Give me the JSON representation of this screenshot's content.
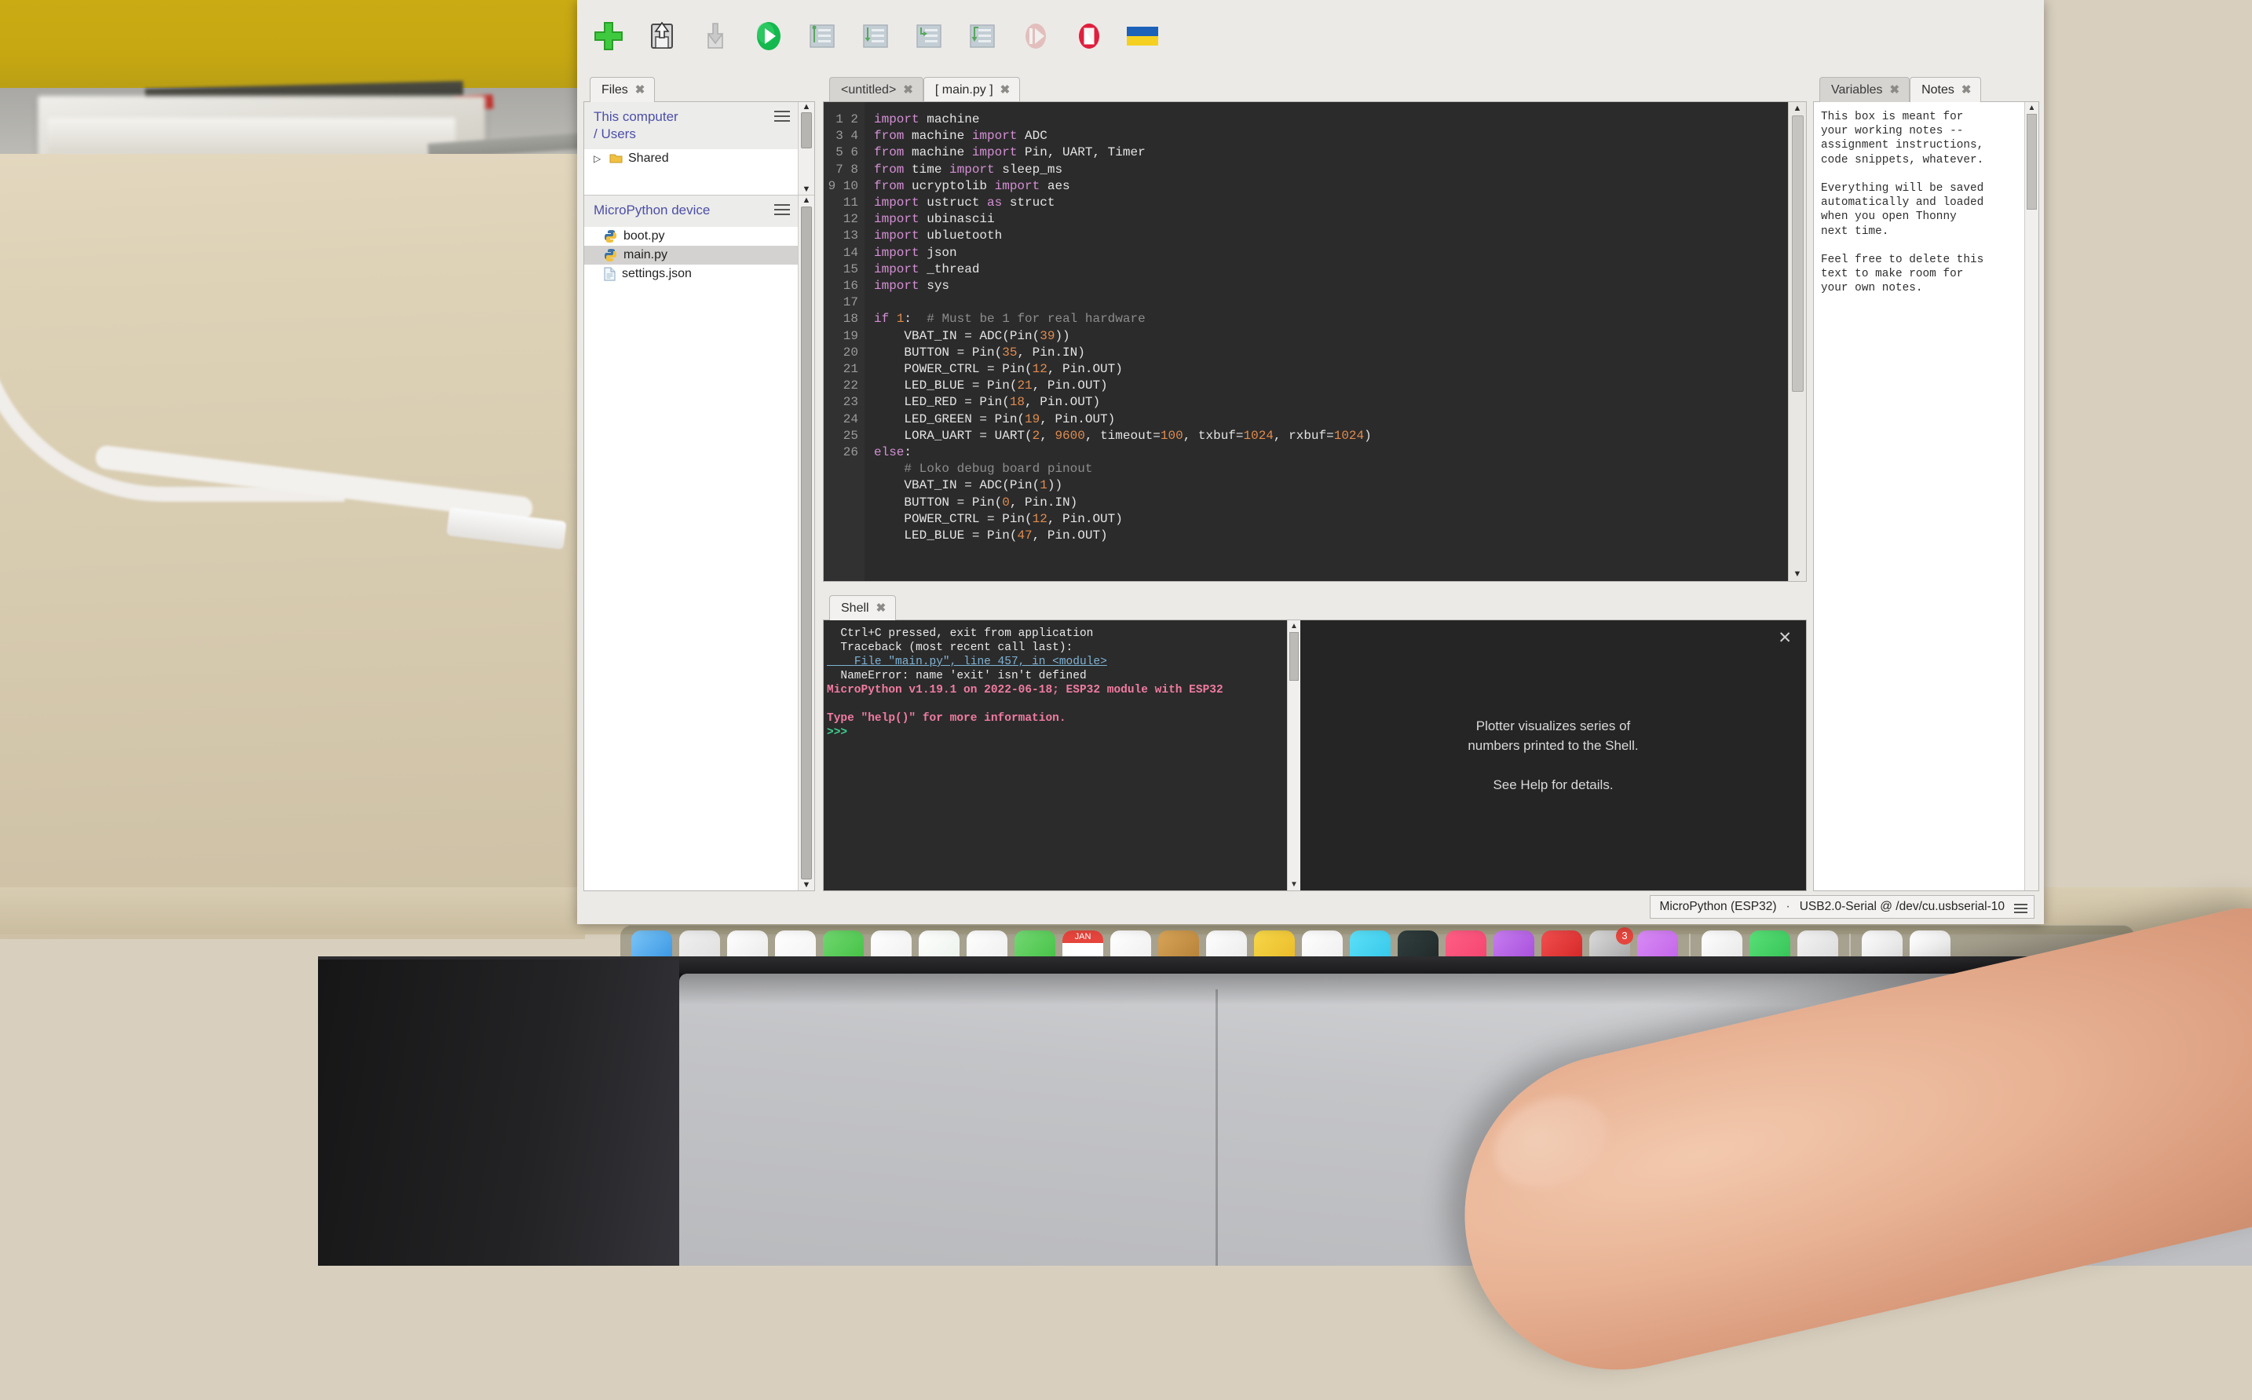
{
  "window": {
    "app": "Thonny"
  },
  "toolbar": {
    "buttons": [
      {
        "name": "new-file",
        "label": "New"
      },
      {
        "name": "save-file",
        "label": "Save"
      },
      {
        "name": "open-file",
        "label": "Open"
      },
      {
        "name": "run-script",
        "label": "Run current script"
      },
      {
        "name": "debug-script",
        "label": "Debug current script"
      },
      {
        "name": "step-over",
        "label": "Step over"
      },
      {
        "name": "step-into",
        "label": "Step into"
      },
      {
        "name": "step-out",
        "label": "Step out"
      },
      {
        "name": "resume",
        "label": "Resume"
      },
      {
        "name": "stop-script",
        "label": "Stop/Restart backend"
      },
      {
        "name": "ukraine-flag",
        "label": "Support Ukraine"
      }
    ]
  },
  "files_panel": {
    "tab": {
      "label": "Files",
      "close": "✖"
    },
    "sections": [
      {
        "title_line1": "This computer",
        "title_line2": "/ Users",
        "menu_icon": "hamburger-icon",
        "rows": [
          {
            "arrow": "▷",
            "icon": "folder-icon",
            "label": "Shared",
            "selected": false
          }
        ]
      },
      {
        "title_line1": "MicroPython device",
        "title_line2": "",
        "menu_icon": "hamburger-icon",
        "rows": [
          {
            "arrow": "",
            "icon": "python-file-icon",
            "label": "boot.py",
            "selected": false
          },
          {
            "arrow": "",
            "icon": "python-file-icon",
            "label": "main.py",
            "selected": true
          },
          {
            "arrow": "",
            "icon": "json-file-icon",
            "label": "settings.json",
            "selected": false
          }
        ]
      }
    ]
  },
  "editor": {
    "tabs": [
      {
        "label": "<untitled>",
        "close": "✖",
        "active": false
      },
      {
        "label": "[ main.py ]",
        "close": "✖",
        "active": true
      }
    ],
    "first_line": 1,
    "lines": [
      {
        "n": 1,
        "tokens": [
          [
            "kw",
            "import"
          ],
          [
            "idt",
            " machine"
          ]
        ]
      },
      {
        "n": 2,
        "tokens": [
          [
            "kw",
            "from"
          ],
          [
            "idt",
            " machine "
          ],
          [
            "kw",
            "import"
          ],
          [
            "idt",
            " ADC"
          ]
        ]
      },
      {
        "n": 3,
        "tokens": [
          [
            "kw",
            "from"
          ],
          [
            "idt",
            " machine "
          ],
          [
            "kw",
            "import"
          ],
          [
            "idt",
            " Pin, UART, Timer"
          ]
        ]
      },
      {
        "n": 4,
        "tokens": [
          [
            "kw",
            "from"
          ],
          [
            "idt",
            " time "
          ],
          [
            "kw",
            "import"
          ],
          [
            "idt",
            " sleep_ms"
          ]
        ]
      },
      {
        "n": 5,
        "tokens": [
          [
            "kw",
            "from"
          ],
          [
            "idt",
            " ucryptolib "
          ],
          [
            "kw",
            "import"
          ],
          [
            "idt",
            " aes"
          ]
        ]
      },
      {
        "n": 6,
        "tokens": [
          [
            "kw",
            "import"
          ],
          [
            "idt",
            " ustruct "
          ],
          [
            "kw",
            "as"
          ],
          [
            "idt",
            " struct"
          ]
        ]
      },
      {
        "n": 7,
        "tokens": [
          [
            "kw",
            "import"
          ],
          [
            "idt",
            " ubinascii"
          ]
        ]
      },
      {
        "n": 8,
        "tokens": [
          [
            "kw",
            "import"
          ],
          [
            "idt",
            " ubluetooth"
          ]
        ]
      },
      {
        "n": 9,
        "tokens": [
          [
            "kw",
            "import"
          ],
          [
            "idt",
            " json"
          ]
        ]
      },
      {
        "n": 10,
        "tokens": [
          [
            "kw",
            "import"
          ],
          [
            "idt",
            " _thread"
          ]
        ]
      },
      {
        "n": 11,
        "tokens": [
          [
            "kw",
            "import"
          ],
          [
            "idt",
            " sys"
          ]
        ]
      },
      {
        "n": 12,
        "tokens": [
          [
            "idt",
            ""
          ]
        ]
      },
      {
        "n": 13,
        "tokens": [
          [
            "kw",
            "if"
          ],
          [
            "idt",
            " "
          ],
          [
            "num",
            "1"
          ],
          [
            "idt",
            ":  "
          ],
          [
            "cm",
            "# Must be 1 for real hardware"
          ]
        ]
      },
      {
        "n": 14,
        "tokens": [
          [
            "idt",
            "    VBAT_IN = ADC(Pin("
          ],
          [
            "num",
            "39"
          ],
          [
            "idt",
            "))"
          ]
        ]
      },
      {
        "n": 15,
        "tokens": [
          [
            "idt",
            "    BUTTON = Pin("
          ],
          [
            "num",
            "35"
          ],
          [
            "idt",
            ", Pin.IN)"
          ]
        ]
      },
      {
        "n": 16,
        "tokens": [
          [
            "idt",
            "    POWER_CTRL = Pin("
          ],
          [
            "num",
            "12"
          ],
          [
            "idt",
            ", Pin.OUT)"
          ]
        ]
      },
      {
        "n": 17,
        "tokens": [
          [
            "idt",
            "    LED_BLUE = Pin("
          ],
          [
            "num",
            "21"
          ],
          [
            "idt",
            ", Pin.OUT)"
          ]
        ]
      },
      {
        "n": 18,
        "tokens": [
          [
            "idt",
            "    LED_RED = Pin("
          ],
          [
            "num",
            "18"
          ],
          [
            "idt",
            ", Pin.OUT)"
          ]
        ]
      },
      {
        "n": 19,
        "tokens": [
          [
            "idt",
            "    LED_GREEN = Pin("
          ],
          [
            "num",
            "19"
          ],
          [
            "idt",
            ", Pin.OUT)"
          ]
        ]
      },
      {
        "n": 20,
        "tokens": [
          [
            "idt",
            "    LORA_UART = UART("
          ],
          [
            "num",
            "2"
          ],
          [
            "idt",
            ", "
          ],
          [
            "num",
            "9600"
          ],
          [
            "idt",
            ", timeout="
          ],
          [
            "num",
            "100"
          ],
          [
            "idt",
            ", txbuf="
          ],
          [
            "num",
            "1024"
          ],
          [
            "idt",
            ", rxbuf="
          ],
          [
            "num",
            "1024"
          ],
          [
            "idt",
            ")"
          ]
        ]
      },
      {
        "n": 21,
        "tokens": [
          [
            "kw",
            "else"
          ],
          [
            "idt",
            ":"
          ]
        ]
      },
      {
        "n": 22,
        "tokens": [
          [
            "idt",
            "    "
          ],
          [
            "cm",
            "# Loko debug board pinout"
          ]
        ]
      },
      {
        "n": 23,
        "tokens": [
          [
            "idt",
            "    VBAT_IN = ADC(Pin("
          ],
          [
            "num",
            "1"
          ],
          [
            "idt",
            "))"
          ]
        ]
      },
      {
        "n": 24,
        "tokens": [
          [
            "idt",
            "    BUTTON = Pin("
          ],
          [
            "num",
            "0"
          ],
          [
            "idt",
            ", Pin.IN)"
          ]
        ]
      },
      {
        "n": 25,
        "tokens": [
          [
            "idt",
            "    POWER_CTRL = Pin("
          ],
          [
            "num",
            "12"
          ],
          [
            "idt",
            ", Pin.OUT)"
          ]
        ]
      },
      {
        "n": 26,
        "tokens": [
          [
            "idt",
            "    LED_BLUE = Pin("
          ],
          [
            "num",
            "47"
          ],
          [
            "idt",
            ", Pin.OUT)"
          ]
        ]
      }
    ]
  },
  "shell": {
    "tab": {
      "label": "Shell",
      "close": "✖"
    },
    "lines": [
      {
        "style": "out",
        "text": "  Ctrl+C pressed, exit from application"
      },
      {
        "style": "out",
        "text": "  Traceback (most recent call last):"
      },
      {
        "style": "link",
        "text": "    File \"main.py\", line 457, in <module>"
      },
      {
        "style": "out",
        "text": "  NameError: name 'exit' isn't defined"
      },
      {
        "style": "banner",
        "text": "MicroPython v1.19.1 on 2022-06-18; ESP32 module with ESP32"
      },
      {
        "style": "blank",
        "text": ""
      },
      {
        "style": "banner",
        "text": "Type \"help()\" for more information."
      },
      {
        "style": "prompt",
        "text": ">>>"
      }
    ]
  },
  "plotter": {
    "close": "✕",
    "line1": "Plotter visualizes series of",
    "line2": "numbers printed to the Shell.",
    "line3": "See Help for details."
  },
  "right_panel": {
    "tabs": [
      {
        "label": "Variables",
        "close": "✖",
        "active": false
      },
      {
        "label": "Notes",
        "close": "✖",
        "active": true
      }
    ],
    "notes_text": "This box is meant for\nyour working notes --\nassignment instructions,\ncode snippets, whatever.\n\nEverything will be saved\nautomatically and loaded\nwhen you open Thonny\nnext time.\n\nFeel free to delete this\ntext to make room for\nyour own notes."
  },
  "statusbar": {
    "interpreter": "MicroPython (ESP32)",
    "separator": "·",
    "port": "USB2.0-Serial @ /dev/cu.usbserial-10",
    "menu_icon": "hamburger-icon"
  },
  "desktop": {
    "dock_left_icons": [
      "#3b9ef0",
      "#e8a33d",
      "#2f7fd6",
      "#dc2b2b",
      "#5dc35d",
      "#2f6fd0",
      "#49b0a0",
      "#f0a23c",
      "#5dc35d",
      "#e5453c",
      "#2f8fe0",
      "#c48a3f",
      "#f0f0f0",
      "#f2c02a"
    ],
    "dock_right_icons": [
      "#2fc4e8",
      "#232b2b",
      "#f2416b",
      "#b45de0",
      "#e02f2f",
      "#4a4a4a",
      "#c44ae0",
      "#2f9fe8",
      "#35d05e",
      "#cfcfcf",
      "#efefef",
      "#ffffff"
    ],
    "dock_badge": "3",
    "dock_calendar_label": "JAN"
  }
}
